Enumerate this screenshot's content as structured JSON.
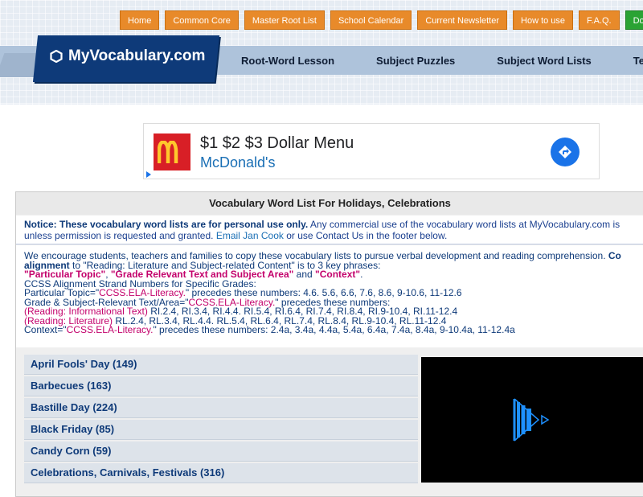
{
  "top_nav": [
    "Home",
    "Common Core",
    "Master Root List",
    "School Calendar",
    "Current Newsletter",
    "How to use",
    "F.A.Q.",
    "Donate"
  ],
  "logo": {
    "text": "MyVocabulary.com"
  },
  "main_nav": [
    "Root-Word Lesson",
    "Subject Puzzles",
    "Subject Word Lists",
    "Test Pre"
  ],
  "ad": {
    "title": "$1 $2 $3 Dollar Menu",
    "brand": "McDonald's",
    "choices_icon": "ad-choices-icon"
  },
  "panel": {
    "title": "Vocabulary Word List For Holidays, Celebrations",
    "notice_bold": "Notice: These vocabulary word lists are for personal use only.",
    "notice_text1": " Any commercial use of the vocabulary word lists at MyVocabulary.com is",
    "notice_text2": "unless permission is requested and granted.",
    "notice_link": "Email Jan Cook",
    "notice_text3": " or use Contact Us in the footer below."
  },
  "ccss": {
    "line1_a": "We encourage students, teachers and families to copy these vocabulary lists to pursue verbal development and reading comprehension. ",
    "line1_b": "Co",
    "line2_a": "alignment",
    "line2_b": " to \"Reading: Literature and Subject-related Content\" is to 3 key phrases:",
    "line3_a": "\"Particular Topic\"",
    "line3_b": ", ",
    "line3_c": "\"Grade Relevant Text and Subject Area\"",
    "line3_d": " and ",
    "line3_e": "\"Context\"",
    "line3_f": ".",
    "line4": "CCSS Alignment Strand Numbers for Specific Grades:",
    "line5_a": "Particular Topic=\"",
    "line5_b": "CCSS.ELA-Literacy.",
    "line5_c": "\" precedes these numbers: 4.6. 5.6, 6.6, 7.6, 8.6, 9-10.6, 11-12.6",
    "line6_a": "Grade & Subject-Relevant Text/Area=\"",
    "line6_b": "CCSS.ELA-Literacy.",
    "line6_c": "\" precedes these numbers:",
    "line7_a": "(Reading: Informational Text)",
    "line7_b": " RI.2.4, RI.3.4, RI.4.4. RI.5.4, RI.6.4, RI.7.4, RI.8.4, RI.9-10.4, RI.11-12.4",
    "line8_a": "(Reading: Literature)",
    "line8_b": " RL.2.4, RL.3.4, RL.4.4. RL.5.4, RL.6.4, RL.7.4, RL.8.4, RL.9-10.4, RL.11-12.4",
    "line9_a": "Context=\"",
    "line9_b": "CCSS.ELA-Literacy.",
    "line9_c": "\" precedes these numbers: 2.4a, 3.4a, 4.4a, 5.4a, 6.4a, 7.4a, 8.4a, 9-10.4a, 11-12.4a"
  },
  "lists": [
    "April Fools' Day (149)",
    "Barbecues (163)",
    "Bastille Day (224)",
    "Black Friday (85)",
    "Candy Corn (59)",
    "Celebrations, Carnivals, Festivals (316)"
  ],
  "colors": {
    "orange": "#e88a2a",
    "green": "#2aa334",
    "navy": "#0e3a79",
    "pink": "#c3006b"
  }
}
